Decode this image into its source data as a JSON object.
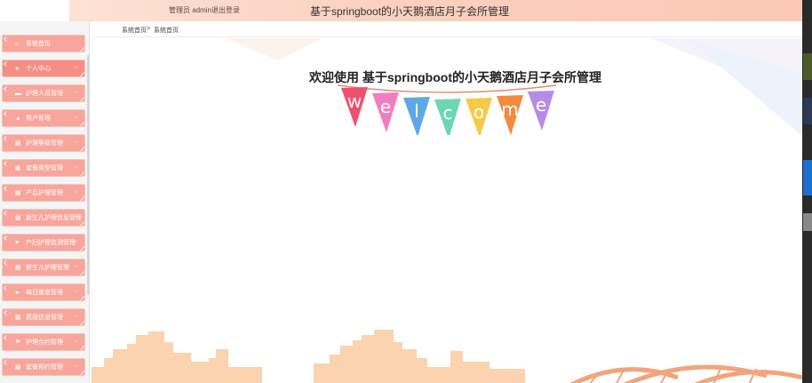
{
  "header": {
    "user_label": "管理员 admin",
    "logout_label": "退出登录",
    "title": "基于springboot的小天鹅酒店月子会所管理"
  },
  "breadcrumb": {
    "home": "系统首页",
    "separator": ">",
    "current": "系统首页"
  },
  "sidebar": {
    "items": [
      {
        "label": "系统首页",
        "icon": "home-icon",
        "glyph": "⌂"
      },
      {
        "label": "个人中心",
        "icon": "user-icon",
        "glyph": "●"
      },
      {
        "label": "护理人员管理",
        "icon": "nurse-icon",
        "glyph": "▬"
      },
      {
        "label": "用户管理",
        "icon": "thumb-icon",
        "glyph": "▲"
      },
      {
        "label": "护理等级管理",
        "icon": "grid-icon",
        "glyph": "▦"
      },
      {
        "label": "套餐类型管理",
        "icon": "card-icon",
        "glyph": "▣"
      },
      {
        "label": "产后护理管理",
        "icon": "apps-icon",
        "glyph": "▦"
      },
      {
        "label": "新生儿护理信息管理",
        "icon": "apps-icon",
        "glyph": "▦"
      },
      {
        "label": "产妇护理监测管理",
        "icon": "heart-icon",
        "glyph": "♥"
      },
      {
        "label": "新生儿护理管理",
        "icon": "apps-icon",
        "glyph": "▦"
      },
      {
        "label": "每日膳食管理",
        "icon": "person-icon",
        "glyph": "●"
      },
      {
        "label": "费用信息管理",
        "icon": "apps-icon",
        "glyph": "▦"
      },
      {
        "label": "护理合约管理",
        "icon": "flag-icon",
        "glyph": "⚑"
      },
      {
        "label": "套餐预约管理",
        "icon": "apps-icon",
        "glyph": "▦"
      }
    ]
  },
  "main": {
    "welcome_text": "欢迎使用 基于springboot的小天鹅酒店月子会所管理",
    "bunting_letters": [
      "w",
      "e",
      "l",
      "c",
      "o",
      "m",
      "e"
    ],
    "bunting_colors": [
      "#f0506e",
      "#f47cc3",
      "#5fa8e8",
      "#6ed6b5",
      "#f7c948",
      "#f58a3c",
      "#b48ce8"
    ]
  },
  "colors": {
    "nav_item": "#f8a59b",
    "nav_item_active": "#f58f86",
    "header_gradient_end": "#fbc9b5",
    "skyline": "#fbd3ae"
  }
}
